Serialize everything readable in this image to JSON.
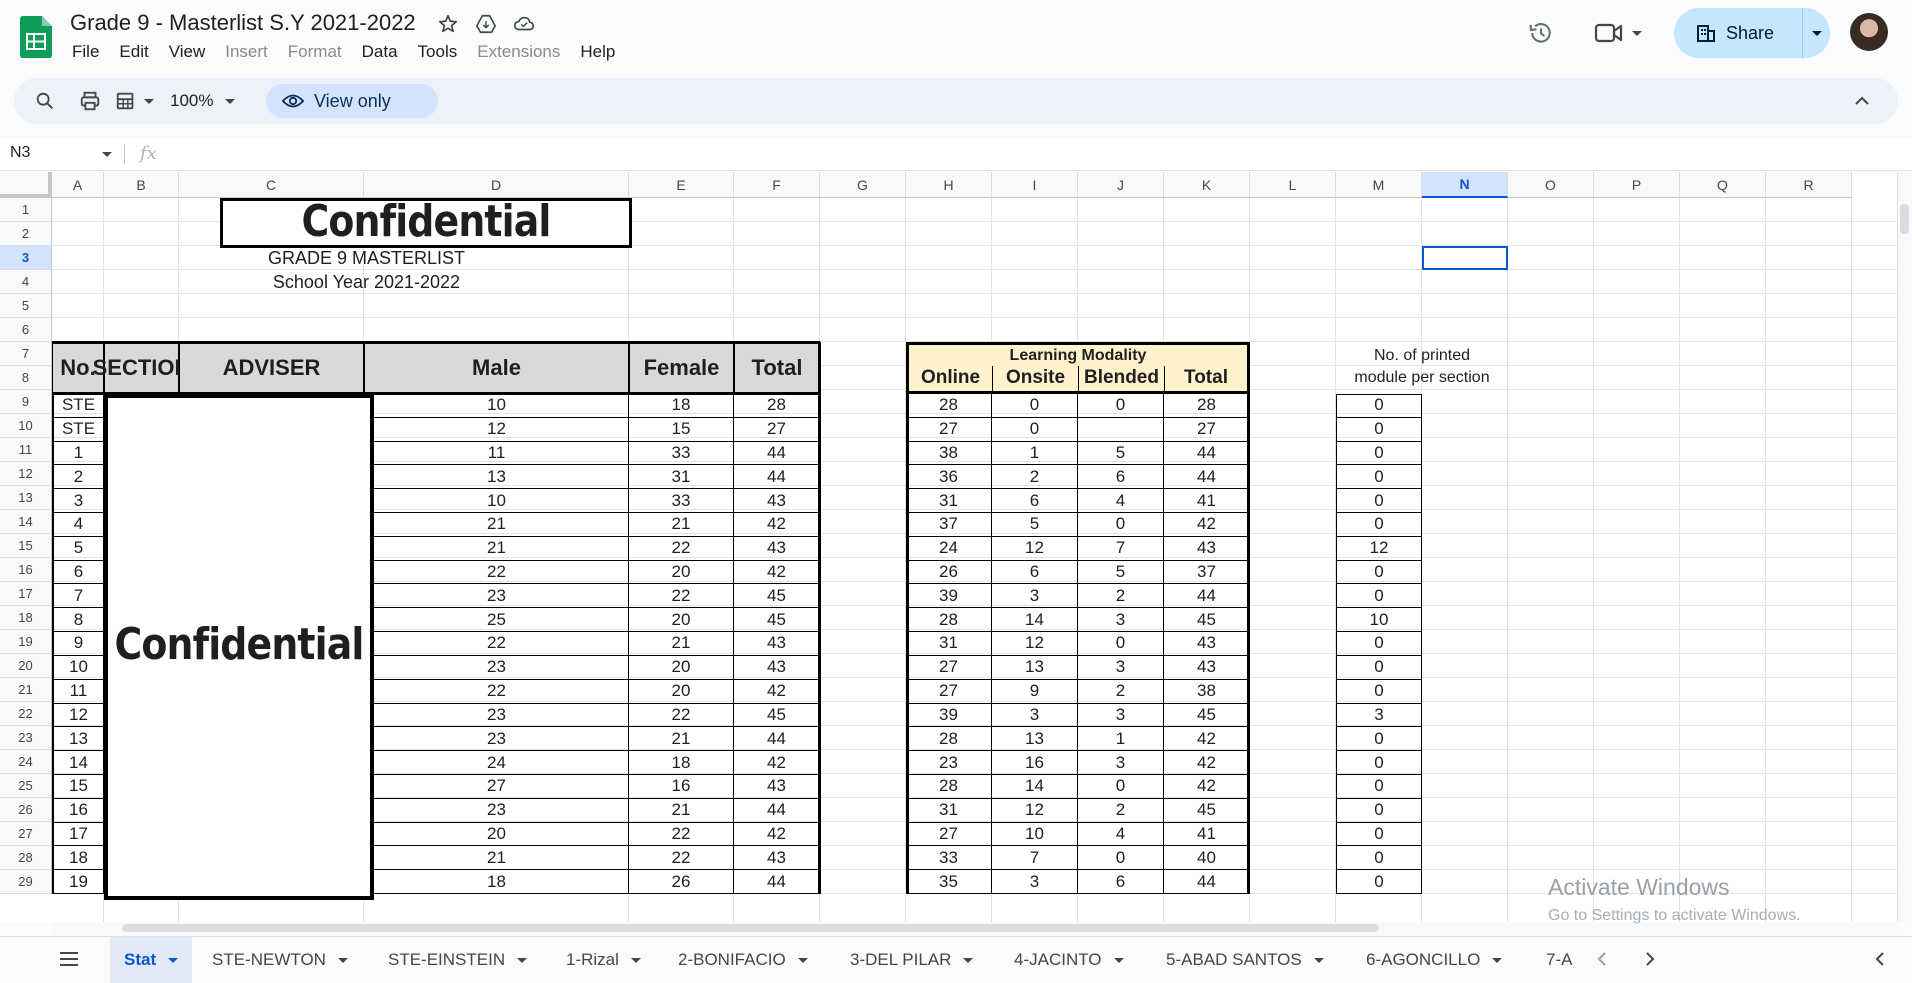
{
  "app": {
    "doc_title": "Grade 9 - Masterlist S.Y 2021-2022",
    "menu": [
      {
        "label": "File",
        "enabled": true
      },
      {
        "label": "Edit",
        "enabled": true
      },
      {
        "label": "View",
        "enabled": true
      },
      {
        "label": "Insert",
        "enabled": false
      },
      {
        "label": "Format",
        "enabled": false
      },
      {
        "label": "Data",
        "enabled": true
      },
      {
        "label": "Tools",
        "enabled": true
      },
      {
        "label": "Extensions",
        "enabled": false
      },
      {
        "label": "Help",
        "enabled": true
      }
    ],
    "share_label": "Share",
    "accent": "#0b57d0",
    "share_bg": "#c2e7ff"
  },
  "toolbar": {
    "zoom": "100%",
    "view_only_label": "View only"
  },
  "formula_bar": {
    "name_box": "N3",
    "fx_label": "fx"
  },
  "grid": {
    "columns": [
      "A",
      "B",
      "C",
      "D",
      "E",
      "F",
      "G",
      "H",
      "I",
      "J",
      "K",
      "L",
      "M",
      "N",
      "O",
      "P",
      "Q",
      "R"
    ],
    "selected_column": "N",
    "rows": [
      "1",
      "2",
      "3",
      "4",
      "5",
      "6",
      "7",
      "8",
      "9",
      "10",
      "11",
      "12",
      "13",
      "14",
      "15",
      "16",
      "17",
      "18",
      "19",
      "20",
      "21",
      "22",
      "23",
      "24",
      "25",
      "26",
      "27",
      "28",
      "29"
    ],
    "selected_row": "3"
  },
  "sheet": {
    "confidential_title": "Confidential",
    "subtitle": "GRADE 9 MASTERLIST",
    "school_year": "School Year  2021-2022",
    "headers": {
      "no": "No.",
      "section": "SECTION",
      "adviser": "ADVISER",
      "male": "Male",
      "female": "Female",
      "total": "Total"
    },
    "modality": {
      "title": "Learning Modality",
      "online": "Online",
      "onsite": "Onsite",
      "blended": "Blended",
      "total": "Total"
    },
    "module_header_line1": "No. of printed",
    "module_header_line2": "module per section",
    "confidential_block": "Confidential",
    "rows": [
      {
        "no": "STE",
        "male": "10",
        "female": "18",
        "total": "28",
        "online": "28",
        "onsite": "0",
        "blended": "0",
        "mtotal": "28",
        "modules": "0"
      },
      {
        "no": "STE",
        "male": "12",
        "female": "15",
        "total": "27",
        "online": "27",
        "onsite": "0",
        "blended": "",
        "mtotal": "27",
        "modules": "0"
      },
      {
        "no": "1",
        "male": "11",
        "female": "33",
        "total": "44",
        "online": "38",
        "onsite": "1",
        "blended": "5",
        "mtotal": "44",
        "modules": "0"
      },
      {
        "no": "2",
        "male": "13",
        "female": "31",
        "total": "44",
        "online": "36",
        "onsite": "2",
        "blended": "6",
        "mtotal": "44",
        "modules": "0"
      },
      {
        "no": "3",
        "male": "10",
        "female": "33",
        "total": "43",
        "online": "31",
        "onsite": "6",
        "blended": "4",
        "mtotal": "41",
        "modules": "0"
      },
      {
        "no": "4",
        "male": "21",
        "female": "21",
        "total": "42",
        "online": "37",
        "onsite": "5",
        "blended": "0",
        "mtotal": "42",
        "modules": "0"
      },
      {
        "no": "5",
        "male": "21",
        "female": "22",
        "total": "43",
        "online": "24",
        "onsite": "12",
        "blended": "7",
        "mtotal": "43",
        "modules": "12"
      },
      {
        "no": "6",
        "male": "22",
        "female": "20",
        "total": "42",
        "online": "26",
        "onsite": "6",
        "blended": "5",
        "mtotal": "37",
        "modules": "0"
      },
      {
        "no": "7",
        "male": "23",
        "female": "22",
        "total": "45",
        "online": "39",
        "onsite": "3",
        "blended": "2",
        "mtotal": "44",
        "modules": "0"
      },
      {
        "no": "8",
        "male": "25",
        "female": "20",
        "total": "45",
        "online": "28",
        "onsite": "14",
        "blended": "3",
        "mtotal": "45",
        "modules": "10"
      },
      {
        "no": "9",
        "male": "22",
        "female": "21",
        "total": "43",
        "online": "31",
        "onsite": "12",
        "blended": "0",
        "mtotal": "43",
        "modules": "0"
      },
      {
        "no": "10",
        "male": "23",
        "female": "20",
        "total": "43",
        "online": "27",
        "onsite": "13",
        "blended": "3",
        "mtotal": "43",
        "modules": "0"
      },
      {
        "no": "11",
        "male": "22",
        "female": "20",
        "total": "42",
        "online": "27",
        "onsite": "9",
        "blended": "2",
        "mtotal": "38",
        "modules": "0"
      },
      {
        "no": "12",
        "male": "23",
        "female": "22",
        "total": "45",
        "online": "39",
        "onsite": "3",
        "blended": "3",
        "mtotal": "45",
        "modules": "3"
      },
      {
        "no": "13",
        "male": "23",
        "female": "21",
        "total": "44",
        "online": "28",
        "onsite": "13",
        "blended": "1",
        "mtotal": "42",
        "modules": "0"
      },
      {
        "no": "14",
        "male": "24",
        "female": "18",
        "total": "42",
        "online": "23",
        "onsite": "16",
        "blended": "3",
        "mtotal": "42",
        "modules": "0"
      },
      {
        "no": "15",
        "male": "27",
        "female": "16",
        "total": "43",
        "online": "28",
        "onsite": "14",
        "blended": "0",
        "mtotal": "42",
        "modules": "0"
      },
      {
        "no": "16",
        "male": "23",
        "female": "21",
        "total": "44",
        "online": "31",
        "onsite": "12",
        "blended": "2",
        "mtotal": "45",
        "modules": "0"
      },
      {
        "no": "17",
        "male": "20",
        "female": "22",
        "total": "42",
        "online": "27",
        "onsite": "10",
        "blended": "4",
        "mtotal": "41",
        "modules": "0"
      },
      {
        "no": "18",
        "male": "21",
        "female": "22",
        "total": "43",
        "online": "33",
        "onsite": "7",
        "blended": "0",
        "mtotal": "40",
        "modules": "0"
      },
      {
        "no": "19",
        "male": "18",
        "female": "26",
        "total": "44",
        "online": "35",
        "onsite": "3",
        "blended": "6",
        "mtotal": "44",
        "modules": "0"
      }
    ],
    "modality_header_bg": "#fff2cc",
    "header_bg": "#d9d9d9"
  },
  "watermark": {
    "line1": "Activate Windows",
    "line2": "Go to Settings to activate Windows."
  },
  "tabs": [
    {
      "label": "Stat",
      "active": true
    },
    {
      "label": "STE-NEWTON",
      "active": false
    },
    {
      "label": "STE-EINSTEIN",
      "active": false
    },
    {
      "label": "1-Rizal",
      "active": false
    },
    {
      "label": "2-BONIFACIO",
      "active": false
    },
    {
      "label": "3-DEL PILAR",
      "active": false
    },
    {
      "label": "4-JACINTO",
      "active": false
    },
    {
      "label": "5-ABAD SANTOS",
      "active": false
    },
    {
      "label": "6-AGONCILLO",
      "active": false
    },
    {
      "label": "7-A",
      "active": false
    }
  ]
}
